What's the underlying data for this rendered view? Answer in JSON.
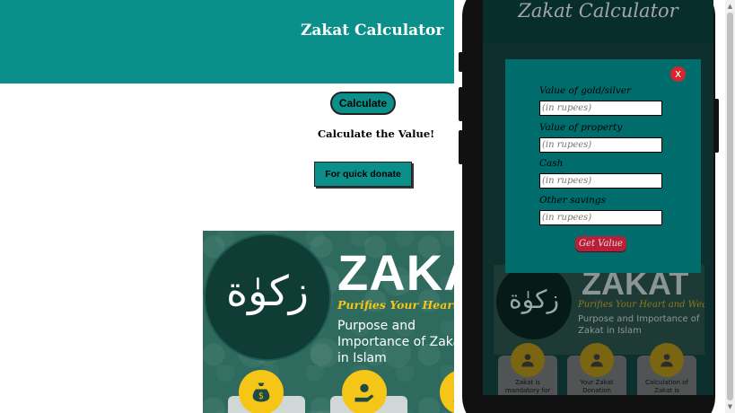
{
  "page": {
    "title": "Zakat Calculator",
    "calculate_button": "Calculate",
    "calculate_text": "Calculate the Value!",
    "donate_button": "For quick donate",
    "banner": {
      "emblem_text": "زکوٰة",
      "headline": "ZAKAT",
      "tagline": "Purifies Your Heart and Wealth",
      "subtitle": "Purpose and Importance of Zakat in Islam"
    }
  },
  "phone": {
    "title": "Zakat Calculator",
    "banner": {
      "emblem_text": "زکوٰة",
      "headline": "ZAKAT",
      "tagline": "Purifies Your Heart and Wealth",
      "subtitle": "Purpose and Importance of Zakat in Islam"
    },
    "cards": [
      {
        "text": "Zakat is mandatory for"
      },
      {
        "text": "Your Zakat Donation"
      },
      {
        "text": "Calculation of Zakat is"
      }
    ],
    "modal": {
      "close_label": "x",
      "fields": [
        {
          "label": "Value of gold/silver",
          "placeholder": "(in rupees)"
        },
        {
          "label": "Value of property",
          "placeholder": "(in rupees)"
        },
        {
          "label": "Cash",
          "placeholder": "(in rupees)"
        },
        {
          "label": "Other savings",
          "placeholder": "(in rupees)"
        }
      ],
      "submit_label": "Get Value"
    }
  },
  "colors": {
    "teal": "#0b8f8b",
    "modal_teal": "#006c6c",
    "gold": "#f5c518",
    "close_red": "#d9262e",
    "button_red": "#b8203a"
  },
  "icons": [
    "money-bag-icon",
    "coin-hand-icon",
    "user-icon",
    "close-icon"
  ]
}
